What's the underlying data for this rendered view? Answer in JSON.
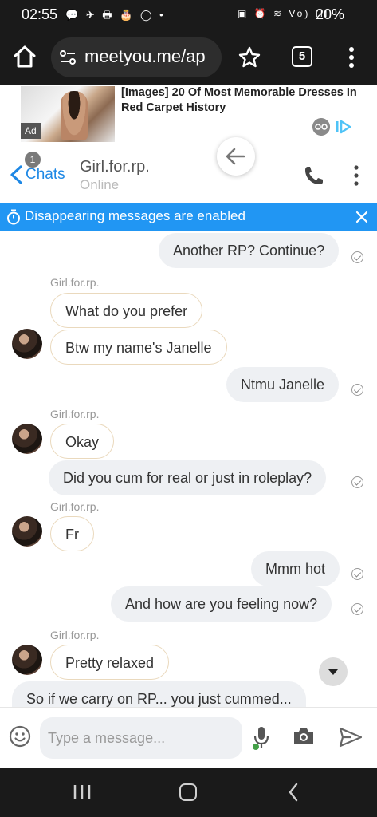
{
  "status_bar": {
    "time": "02:55",
    "left_icons": "💬 ✈ 🖶 🎂 ◯ •",
    "right_icons": "▣ ⏰ ≋ Vo) ıll",
    "battery": "20%"
  },
  "browser": {
    "url": "meetyou.me/ap",
    "tab_count": "5"
  },
  "ad": {
    "label": "Ad",
    "title": "[Images] 20 Of Most Memorable Dresses In Red Carpet History"
  },
  "chat_header": {
    "back_label": "Chats",
    "unread_count": "1",
    "peer_name": "Girl.for.rp.",
    "peer_status": "Online"
  },
  "banner": {
    "text": "Disappearing messages are enabled"
  },
  "messages": [
    {
      "dir": "out",
      "text": "Another RP? Continue?"
    },
    {
      "dir": "in",
      "sender": "Girl.for.rp.",
      "text": "What do you prefer"
    },
    {
      "dir": "in",
      "text": "Btw my name's Janelle"
    },
    {
      "dir": "out",
      "text": "Ntmu Janelle"
    },
    {
      "dir": "in",
      "sender": "Girl.for.rp.",
      "text": "Okay"
    },
    {
      "dir": "out",
      "text": "Did you cum for real or just in roleplay?"
    },
    {
      "dir": "in",
      "sender": "Girl.for.rp.",
      "text": "Fr"
    },
    {
      "dir": "out",
      "text": "Mmm hot"
    },
    {
      "dir": "out",
      "text": "And how are you feeling now?"
    },
    {
      "dir": "in",
      "sender": "Girl.for.rp.",
      "text": "Pretty relaxed"
    },
    {
      "dir": "in",
      "text": "So if we carry on RP... you just cummed..."
    }
  ],
  "composer": {
    "placeholder": "Type a message..."
  },
  "colors": {
    "accent": "#2196f3",
    "link": "#1e88e5",
    "outgoing_bubble": "#eef0f3",
    "incoming_border": "#ead9bd"
  }
}
